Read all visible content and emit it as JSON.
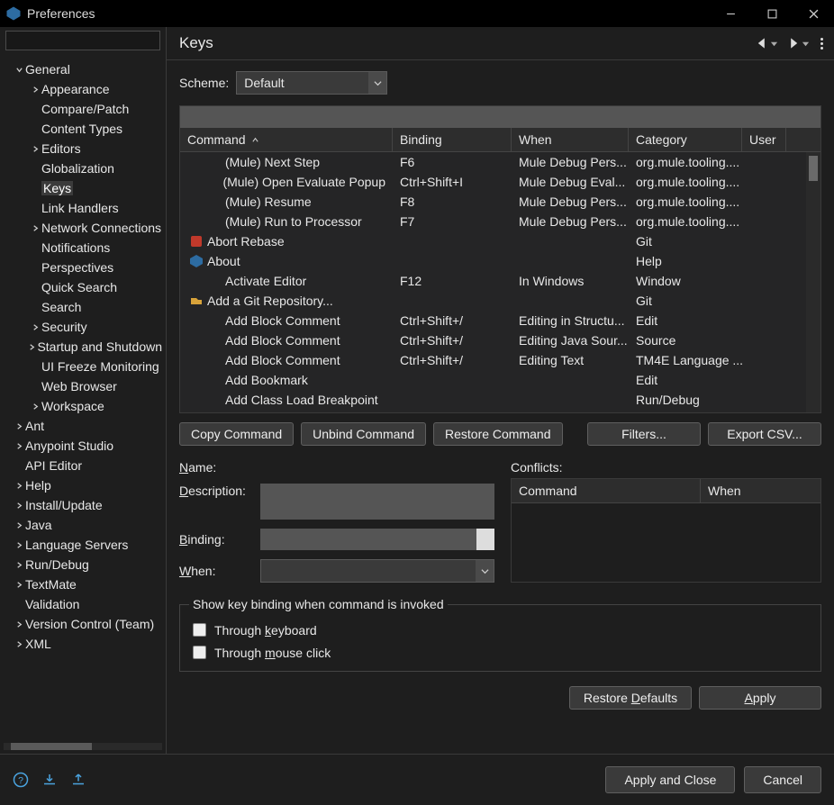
{
  "window": {
    "title": "Preferences"
  },
  "sidebar": {
    "search_placeholder": "",
    "items": [
      {
        "label": "General",
        "depth": 0,
        "expandable": true,
        "expanded": true
      },
      {
        "label": "Appearance",
        "depth": 1,
        "expandable": true,
        "expanded": false
      },
      {
        "label": "Compare/Patch",
        "depth": 1,
        "expandable": false
      },
      {
        "label": "Content Types",
        "depth": 1,
        "expandable": false
      },
      {
        "label": "Editors",
        "depth": 1,
        "expandable": true,
        "expanded": false
      },
      {
        "label": "Globalization",
        "depth": 1,
        "expandable": false
      },
      {
        "label": "Keys",
        "depth": 1,
        "expandable": false,
        "selected": true
      },
      {
        "label": "Link Handlers",
        "depth": 1,
        "expandable": false
      },
      {
        "label": "Network Connections",
        "depth": 1,
        "expandable": true,
        "expanded": false
      },
      {
        "label": "Notifications",
        "depth": 1,
        "expandable": false
      },
      {
        "label": "Perspectives",
        "depth": 1,
        "expandable": false
      },
      {
        "label": "Quick Search",
        "depth": 1,
        "expandable": false
      },
      {
        "label": "Search",
        "depth": 1,
        "expandable": false
      },
      {
        "label": "Security",
        "depth": 1,
        "expandable": true,
        "expanded": false
      },
      {
        "label": "Startup and Shutdown",
        "depth": 1,
        "expandable": true,
        "expanded": false
      },
      {
        "label": "UI Freeze Monitoring",
        "depth": 1,
        "expandable": false
      },
      {
        "label": "Web Browser",
        "depth": 1,
        "expandable": false
      },
      {
        "label": "Workspace",
        "depth": 1,
        "expandable": true,
        "expanded": false
      },
      {
        "label": "Ant",
        "depth": 0,
        "expandable": true,
        "expanded": false
      },
      {
        "label": "Anypoint Studio",
        "depth": 0,
        "expandable": true,
        "expanded": false
      },
      {
        "label": "API Editor",
        "depth": 0,
        "expandable": false
      },
      {
        "label": "Help",
        "depth": 0,
        "expandable": true,
        "expanded": false
      },
      {
        "label": "Install/Update",
        "depth": 0,
        "expandable": true,
        "expanded": false
      },
      {
        "label": "Java",
        "depth": 0,
        "expandable": true,
        "expanded": false
      },
      {
        "label": "Language Servers",
        "depth": 0,
        "expandable": true,
        "expanded": false
      },
      {
        "label": "Run/Debug",
        "depth": 0,
        "expandable": true,
        "expanded": false
      },
      {
        "label": "TextMate",
        "depth": 0,
        "expandable": true,
        "expanded": false
      },
      {
        "label": "Validation",
        "depth": 0,
        "expandable": false
      },
      {
        "label": "Version Control (Team)",
        "depth": 0,
        "expandable": true,
        "expanded": false
      },
      {
        "label": "XML",
        "depth": 0,
        "expandable": true,
        "expanded": false
      }
    ]
  },
  "page": {
    "title": "Keys",
    "scheme_label": "Scheme:",
    "scheme_value": "Default",
    "columns": {
      "command": "Command",
      "binding": "Binding",
      "when": "When",
      "category": "Category",
      "user": "User"
    },
    "rows": [
      {
        "icon": "none",
        "command": "(Mule) Next Step",
        "binding": "F6",
        "when": "Mule Debug Pers...",
        "category": "org.mule.tooling...."
      },
      {
        "icon": "none",
        "command": "(Mule) Open Evaluate Popup",
        "binding": "Ctrl+Shift+I",
        "when": "Mule Debug Eval...",
        "category": "org.mule.tooling...."
      },
      {
        "icon": "none",
        "command": "(Mule) Resume",
        "binding": "F8",
        "when": "Mule Debug Pers...",
        "category": "org.mule.tooling...."
      },
      {
        "icon": "none",
        "command": "(Mule) Run to Processor",
        "binding": "F7",
        "when": "Mule Debug Pers...",
        "category": "org.mule.tooling...."
      },
      {
        "icon": "abort",
        "command": "Abort Rebase",
        "binding": "",
        "when": "",
        "category": "Git"
      },
      {
        "icon": "about",
        "command": "About",
        "binding": "",
        "when": "",
        "category": "Help"
      },
      {
        "icon": "none",
        "command": "Activate Editor",
        "binding": "F12",
        "when": "In Windows",
        "category": "Window"
      },
      {
        "icon": "git",
        "command": "Add a Git Repository...",
        "binding": "",
        "when": "",
        "category": "Git"
      },
      {
        "icon": "none",
        "command": "Add Block Comment",
        "binding": "Ctrl+Shift+/",
        "when": "Editing in Structu...",
        "category": "Edit"
      },
      {
        "icon": "none",
        "command": "Add Block Comment",
        "binding": "Ctrl+Shift+/",
        "when": "Editing Java Sour...",
        "category": "Source"
      },
      {
        "icon": "none",
        "command": "Add Block Comment",
        "binding": "Ctrl+Shift+/",
        "when": "Editing Text",
        "category": "TM4E Language ..."
      },
      {
        "icon": "none",
        "command": "Add Bookmark",
        "binding": "",
        "when": "",
        "category": "Edit"
      },
      {
        "icon": "none",
        "command": "Add Class Load Breakpoint",
        "binding": "",
        "when": "",
        "category": "Run/Debug"
      }
    ],
    "buttons": {
      "copy": "Copy Command",
      "unbind": "Unbind Command",
      "restore": "Restore Command",
      "filters": "Filters...",
      "export": "Export CSV..."
    },
    "fields": {
      "name": "Name:",
      "description": "Description:",
      "binding": "Binding:",
      "when": "When:"
    },
    "conflicts": {
      "label": "Conflicts:",
      "columns": {
        "command": "Command",
        "when": "When"
      }
    },
    "show_binding": {
      "legend": "Show key binding when command is invoked",
      "keyboard": "Through keyboard",
      "mouse": "Through mouse click"
    },
    "page_buttons": {
      "restore_defaults": "Restore Defaults",
      "apply": "Apply"
    }
  },
  "footer": {
    "apply_close": "Apply and Close",
    "cancel": "Cancel"
  }
}
